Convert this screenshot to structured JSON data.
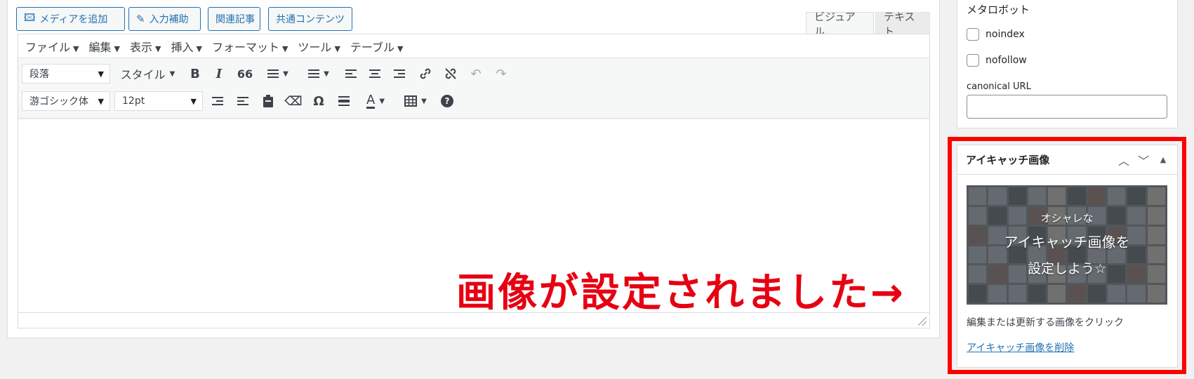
{
  "editor": {
    "buttons": {
      "add_media": "メディアを追加",
      "input_assist": "入力補助",
      "related_posts": "関連記事",
      "shared_content": "共通コンテンツ"
    },
    "tabs": {
      "visual": "ビジュアル",
      "text": "テキスト"
    },
    "menubar": [
      "ファイル",
      "編集",
      "表示",
      "挿入",
      "フォーマット",
      "ツール",
      "テーブル"
    ],
    "toolbar": {
      "paragraph_select": "段落",
      "style_label": "スタイル",
      "font_select": "游ゴシック体",
      "size_select": "12pt",
      "bold": "B",
      "italic": "I",
      "quote": "66",
      "omega": "Ω",
      "text_color": "A",
      "help": "?"
    }
  },
  "annotation": {
    "text": "画像が設定されました→",
    "color": "#e60012"
  },
  "sidebar": {
    "meta_robots": {
      "title": "メタロボット",
      "noindex": "noindex",
      "nofollow": "nofollow",
      "canonical_label": "canonical URL",
      "canonical_value": ""
    },
    "featured_image": {
      "title": "アイキャッチ画像",
      "thumb_line1": "オシャレな",
      "thumb_line2": "アイキャッチ画像を",
      "thumb_line3": "設定しよう☆",
      "description": "編集または更新する画像をクリック",
      "remove_link": "アイキャッチ画像を削除",
      "highlight_color": "#ff0000"
    }
  },
  "colors": {
    "accent": "#2271b1",
    "background": "#f1f1f1"
  }
}
